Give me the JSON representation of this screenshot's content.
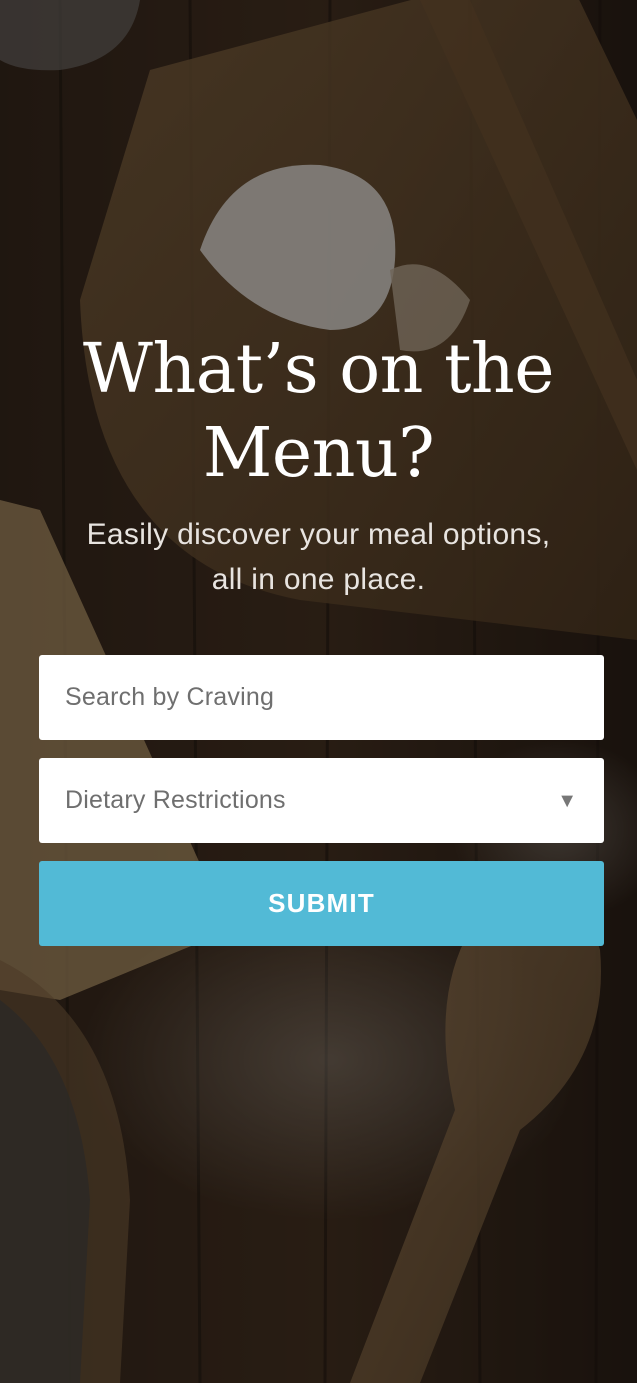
{
  "hero": {
    "title_line1": "What’s on the",
    "title_line2": "Menu?",
    "subtitle_line1": "Easily discover your meal options,",
    "subtitle_line2": "all in one place."
  },
  "search": {
    "placeholder": "Search by Craving",
    "value": ""
  },
  "dietary_select": {
    "selected": "Dietary Restrictions",
    "arrow_icon": "triangle-down-icon"
  },
  "submit": {
    "label": "SUBMIT"
  },
  "colors": {
    "accent": "#52bad6",
    "field_bg": "#ffffff",
    "text_light": "#ffffff",
    "placeholder": "#6f6f6f"
  }
}
